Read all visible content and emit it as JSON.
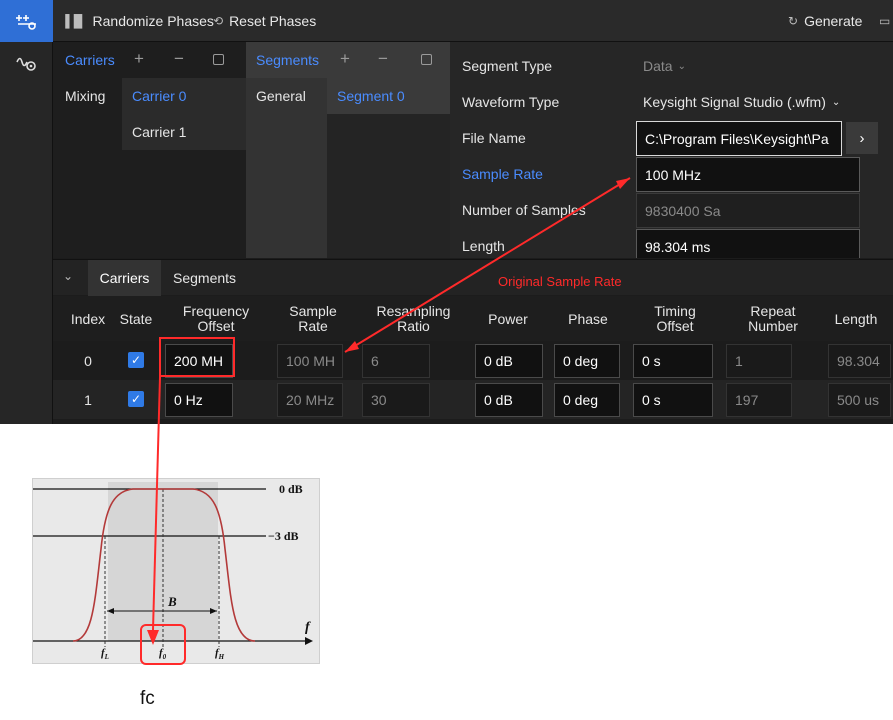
{
  "toolbar": {
    "randomize_label": "Randomize Phases",
    "reset_label": "Reset Phases",
    "generate_label": "Generate"
  },
  "carriers_panel": {
    "title": "Carriers",
    "side_item": "Mixing",
    "items": [
      "Carrier 0",
      "Carrier 1"
    ]
  },
  "segments_panel": {
    "title": "Segments",
    "side_item": "General",
    "items": [
      "Segment 0"
    ]
  },
  "properties": {
    "segment_type": {
      "label": "Segment Type",
      "value": "Data"
    },
    "waveform_type": {
      "label": "Waveform Type",
      "value": "Keysight Signal Studio (.wfm)"
    },
    "file_name": {
      "label": "File Name",
      "value": "C:\\Program Files\\Keysight\\Pa"
    },
    "sample_rate": {
      "label": "Sample Rate",
      "value": "100 MHz"
    },
    "num_samples": {
      "label": "Number of Samples",
      "value": "9830400 Sa"
    },
    "length": {
      "label": "Length",
      "value": "98.304 ms"
    }
  },
  "bottom_tabs": [
    "Carriers",
    "Segments"
  ],
  "table": {
    "headers": {
      "index": "Index",
      "state": "State",
      "freq_offset": [
        "Frequency",
        "Offset"
      ],
      "sample_rate": [
        "Sample",
        "Rate"
      ],
      "resampling": [
        "Resampling",
        "Ratio"
      ],
      "power": "Power",
      "phase": "Phase",
      "timing": [
        "Timing",
        "Offset"
      ],
      "repeat": [
        "Repeat",
        "Number"
      ],
      "length": "Length"
    },
    "rows": [
      {
        "index": "0",
        "freq_offset": "200 MH",
        "sample_rate": "100 MH",
        "resampling": "6",
        "power": "0 dB",
        "phase": "0 deg",
        "timing": "0 s",
        "repeat": "1",
        "length": "98.304"
      },
      {
        "index": "1",
        "freq_offset": "0 Hz",
        "sample_rate": "20 MHz",
        "resampling": "30",
        "power": "0 dB",
        "phase": "0 deg",
        "timing": "0 s",
        "repeat": "197",
        "length": "500 us"
      }
    ]
  },
  "annotations": {
    "original_sample_rate": "Original Sample Rate",
    "fc": "fc"
  },
  "filter_diagram": {
    "level_0db": "0 dB",
    "level_3db": "−3 dB",
    "bandwidth": "B",
    "axis": "f",
    "fl": "f",
    "fl_sub": "L",
    "f0": "f",
    "f0_sub": "0",
    "fh": "f",
    "fh_sub": "H"
  },
  "colors": {
    "accent": "#2f7ae6",
    "annotation": "#ff2a2a"
  }
}
